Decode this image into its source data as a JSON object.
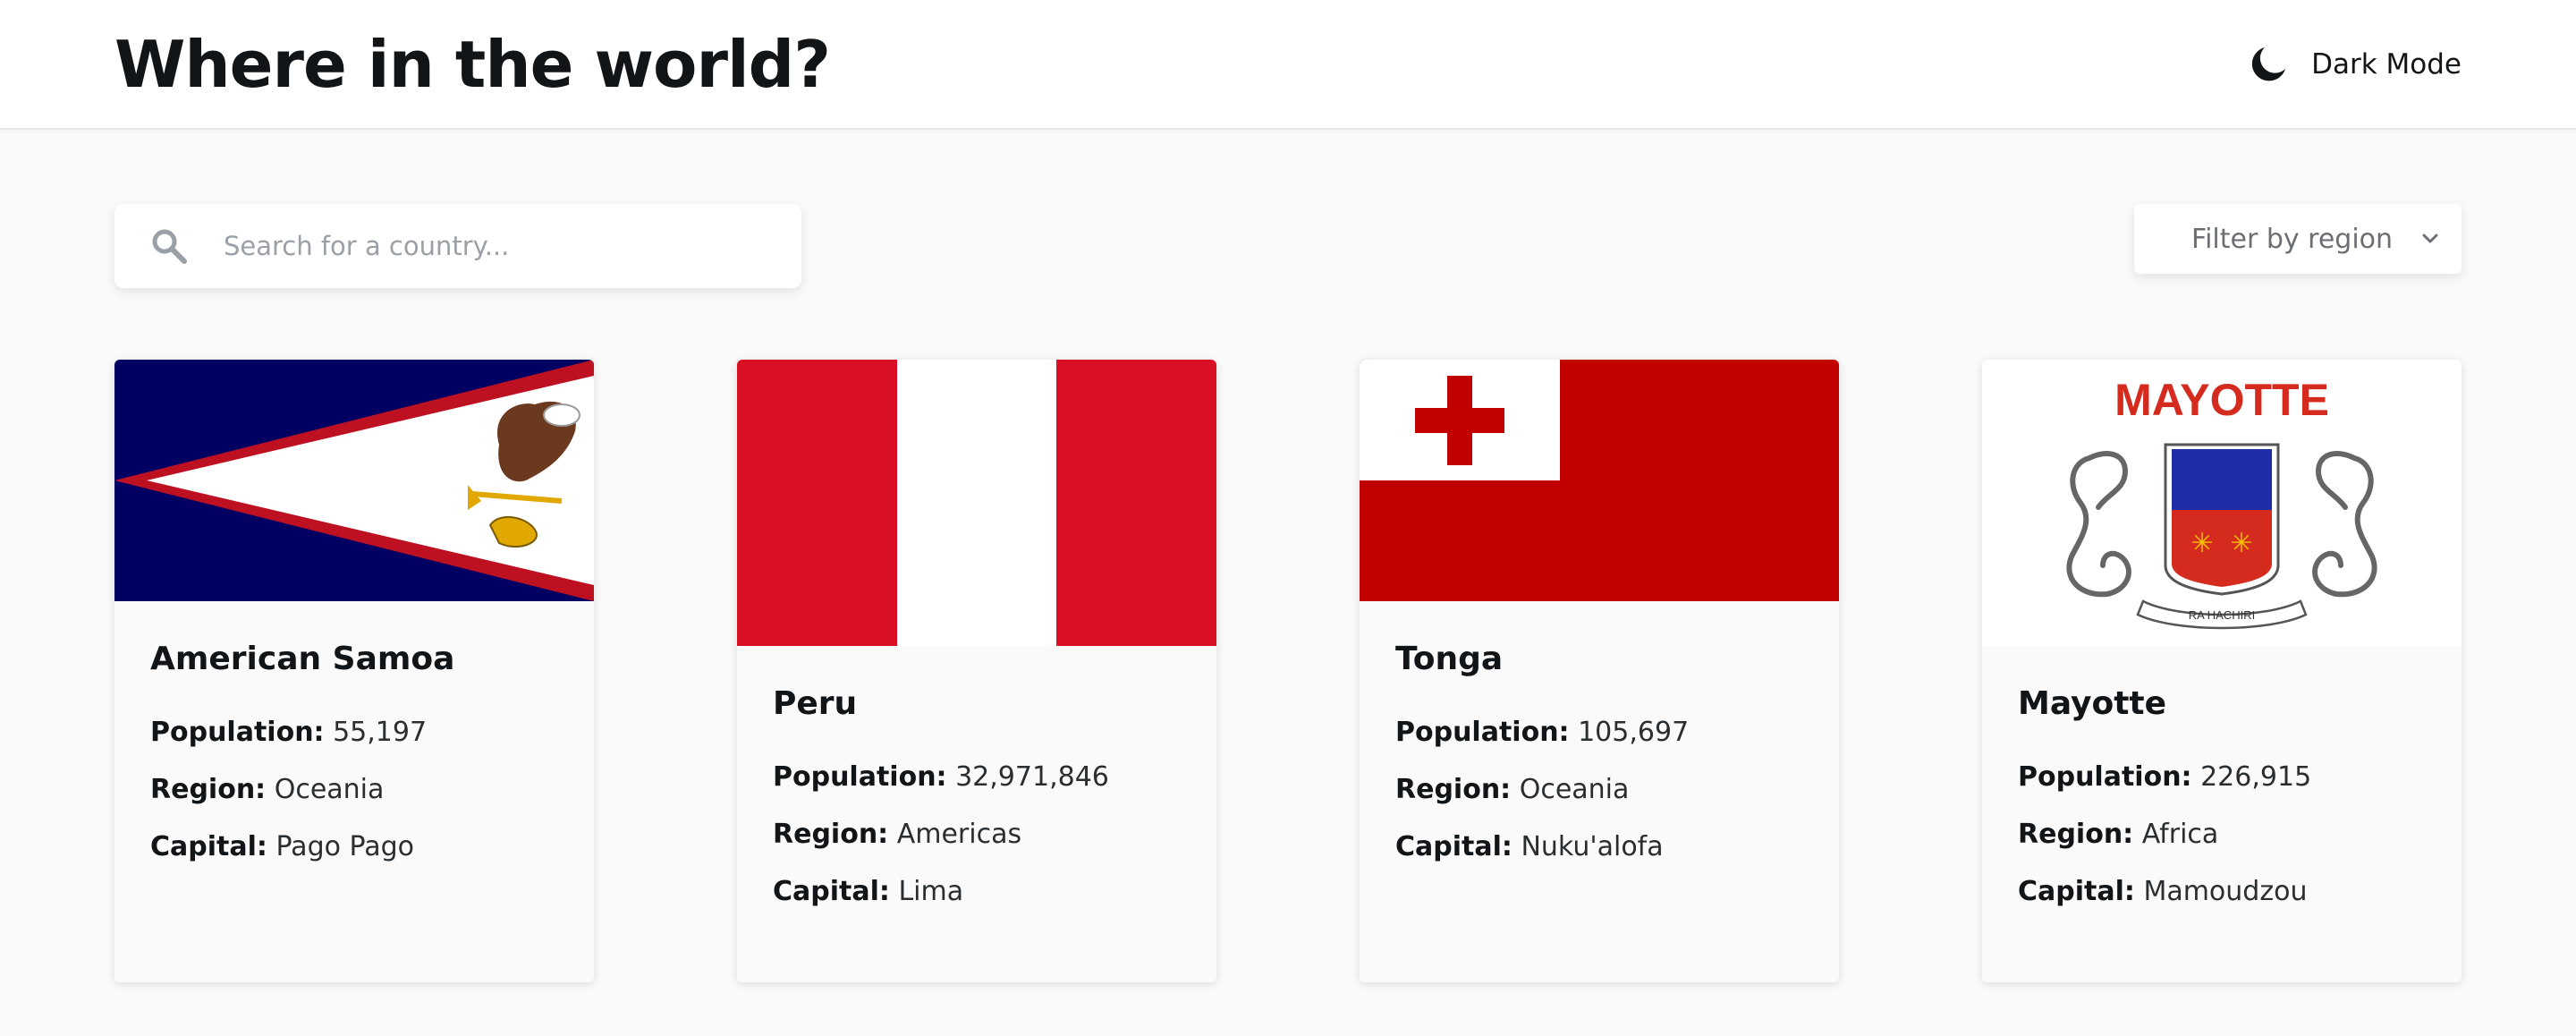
{
  "header": {
    "title": "Where in the world?",
    "theme_toggle_label": "Dark Mode",
    "theme_icon": "moon-icon"
  },
  "search": {
    "placeholder": "Search for a country...",
    "value": "",
    "icon": "search-icon"
  },
  "filter": {
    "label": "Filter by region",
    "icon": "chevron-down-icon"
  },
  "stat_labels": {
    "population": "Population:",
    "region": "Region:",
    "capital": "Capital:"
  },
  "countries": [
    {
      "name": "American Samoa",
      "population": "55,197",
      "region": "Oceania",
      "capital": "Pago Pago",
      "flag_icon": "american-samoa-flag"
    },
    {
      "name": "Peru",
      "population": "32,971,846",
      "region": "Americas",
      "capital": "Lima",
      "flag_icon": "peru-flag"
    },
    {
      "name": "Tonga",
      "population": "105,697",
      "region": "Oceania",
      "capital": "Nuku'alofa",
      "flag_icon": "tonga-flag"
    },
    {
      "name": "Mayotte",
      "population": "226,915",
      "region": "Africa",
      "capital": "Mamoudzou",
      "flag_icon": "mayotte-flag",
      "flag_text": "MAYOTTE",
      "flag_motto": "RA HACHIRI"
    }
  ],
  "colors": {
    "background": "#fafafa",
    "text": "#111517",
    "placeholder": "#9aa0a6",
    "peru_red": "#d91023",
    "tonga_red": "#c10000",
    "samoa_blue": "#000063",
    "samoa_red": "#bd1021"
  }
}
